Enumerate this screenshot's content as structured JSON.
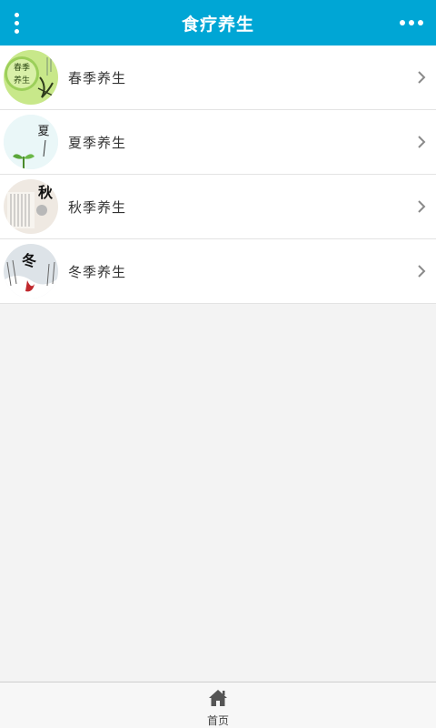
{
  "header": {
    "title": "食疗养生",
    "menu_icon": "vertical-dots-icon",
    "more_icon": "horizontal-dots-icon"
  },
  "list": {
    "items": [
      {
        "label": "春季养生",
        "thumb_text": "春季养生",
        "theme": "spring"
      },
      {
        "label": "夏季养生",
        "thumb_text": "夏",
        "theme": "summer"
      },
      {
        "label": "秋季养生",
        "thumb_text": "秋",
        "theme": "autumn"
      },
      {
        "label": "冬季养生",
        "thumb_text": "冬",
        "theme": "winter"
      }
    ],
    "chevron_icon": "chevron-right-icon"
  },
  "footer": {
    "home_label": "首页",
    "home_icon": "home-icon"
  },
  "colors": {
    "accent": "#00a6d5",
    "background": "#f3f3f3"
  }
}
